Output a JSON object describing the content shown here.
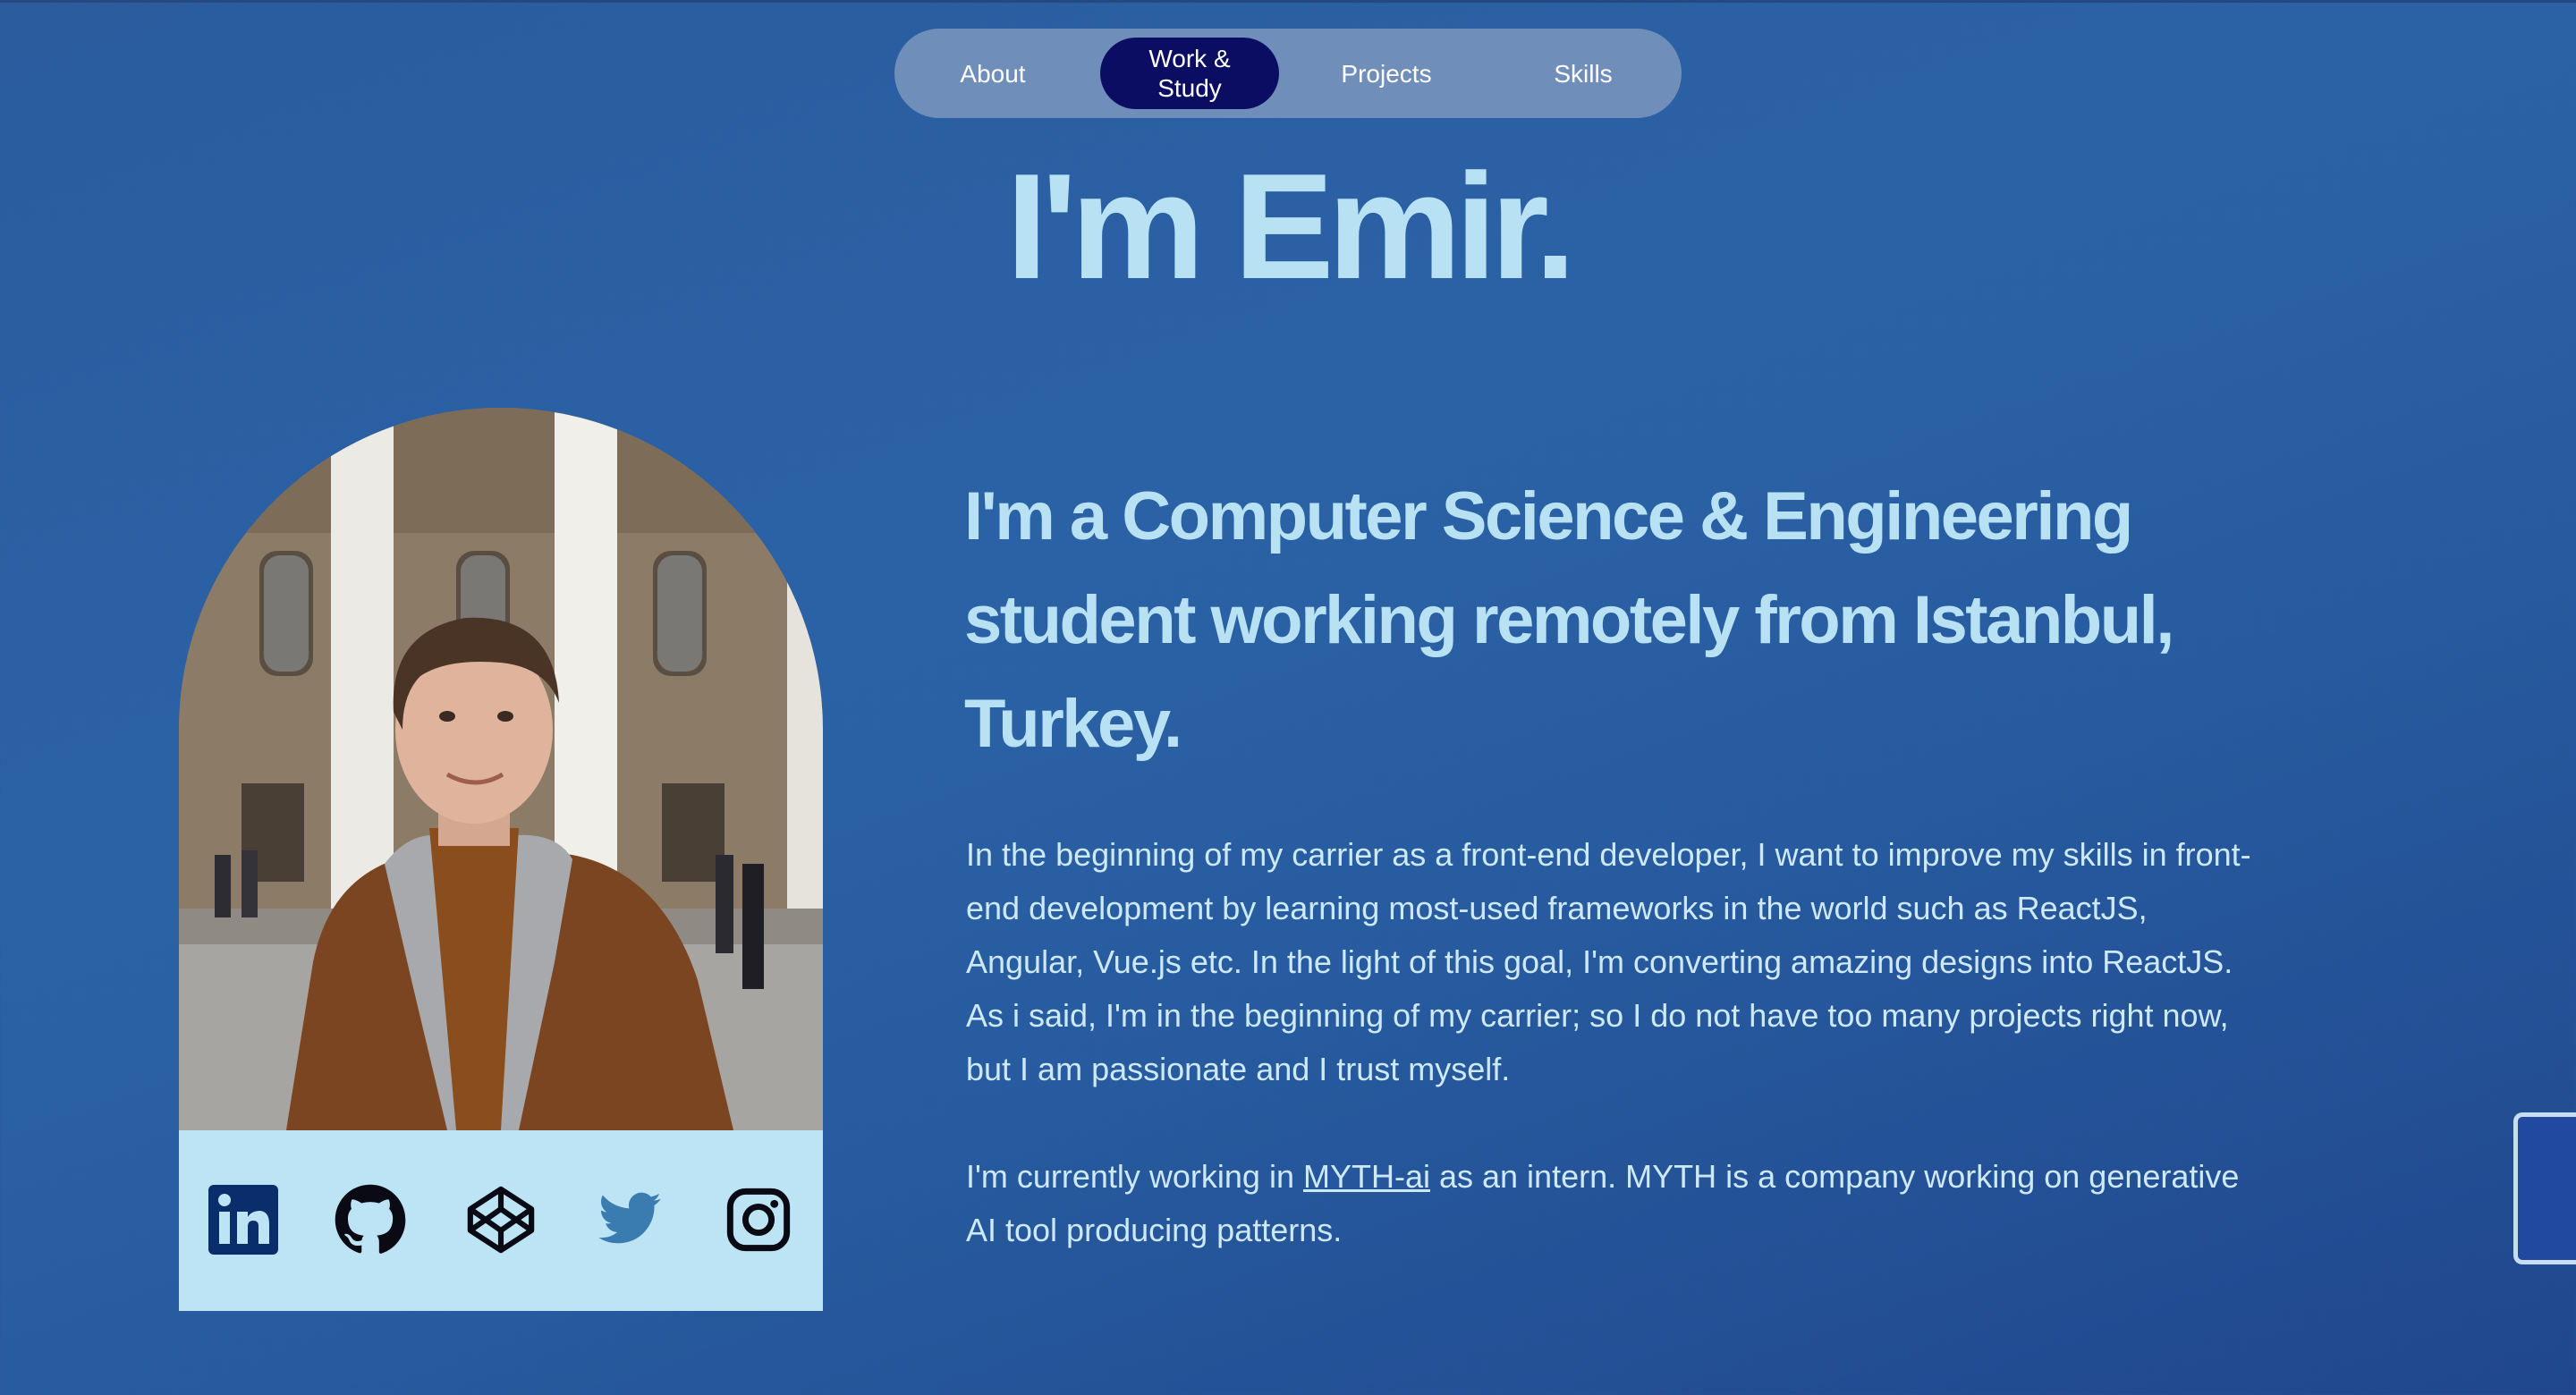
{
  "nav": {
    "items": [
      {
        "label": "About"
      },
      {
        "label": "Work &",
        "label2": "Study",
        "active": true
      },
      {
        "label": "Projects"
      },
      {
        "label": "Skills"
      }
    ]
  },
  "hero": {
    "title": "I'm Emir."
  },
  "profile": {
    "photo_alt": "Portrait photo",
    "socials": [
      {
        "icon": "linkedin-icon"
      },
      {
        "icon": "github-icon"
      },
      {
        "icon": "codepen-icon"
      },
      {
        "icon": "twitter-icon"
      },
      {
        "icon": "instagram-icon"
      }
    ]
  },
  "intro": {
    "headline": "I'm a Computer Science & Engineering student working remotely from Istanbul, Turkey.",
    "paragraph1": "In the beginning of my carrier as a front-end developer, I want to improve my skills in front-end development by learning most-used frameworks in the world such as ReactJS, Angular, Vue.js etc. In the light of this goal, I'm converting amazing designs into ReactJS. As i said, I'm in the beginning of my carrier; so I do not have too many projects right now, but I am passionate and I trust myself.",
    "paragraph2_before": "I'm currently working in ",
    "paragraph2_link": "MYTH-ai",
    "paragraph2_after": " as an intern. MYTH is a company working on generative AI tool producing patterns."
  },
  "colors": {
    "background": "#2b62a6",
    "nav_bg": "#6f8fba",
    "nav_active": "#0b0d63",
    "accent_text": "#b8e2f3",
    "socials_bg": "#bce4f5"
  }
}
